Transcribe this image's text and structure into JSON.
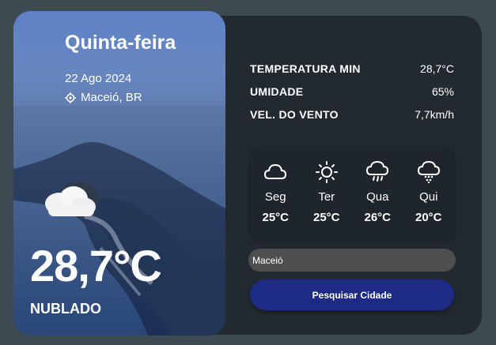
{
  "current": {
    "weekday": "Quinta-feira",
    "date": "22 Ago 2024",
    "location": "Maceió, BR",
    "temperature": "28,7°C",
    "condition": "NUBLADO",
    "condition_icon": "partly-cloudy-icon"
  },
  "stats": [
    {
      "label": "TEMPERATURA MIN",
      "value": "28,7°C"
    },
    {
      "label": "UMIDADE",
      "value": "65%"
    },
    {
      "label": "VEL. DO VENTO",
      "value": "7,7km/h"
    }
  ],
  "forecast": [
    {
      "day": "Seg",
      "temp": "25°C",
      "icon": "cloud-icon"
    },
    {
      "day": "Ter",
      "temp": "25°C",
      "icon": "sun-icon"
    },
    {
      "day": "Qua",
      "temp": "26°C",
      "icon": "rain-cloud-icon"
    },
    {
      "day": "Qui",
      "temp": "20°C",
      "icon": "snow-cloud-icon"
    }
  ],
  "search": {
    "value": "Maceió",
    "button_label": "Pesquisar Cidade"
  }
}
